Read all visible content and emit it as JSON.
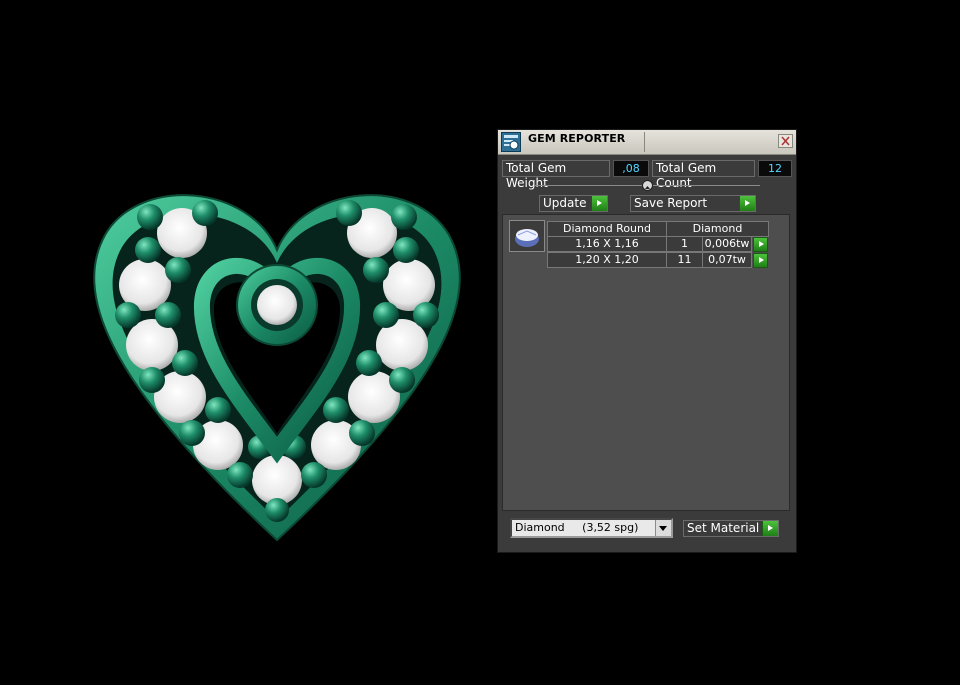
{
  "window": {
    "title": "GEM REPORTER"
  },
  "summary": {
    "weight_label": "Total Gem Weight",
    "weight_value": ",08",
    "count_label": "Total Gem Count",
    "count_value": "12"
  },
  "buttons": {
    "update": "Update",
    "save_report": "Save Report",
    "set_material": "Set Material"
  },
  "report": {
    "gem_type_header": "Diamond Round",
    "material_header": "Diamond",
    "rows": [
      {
        "size": "1,16 X 1,16",
        "count": "1",
        "weight": "0,006tw"
      },
      {
        "size": "1,20 X 1,20",
        "count": "11",
        "weight": "0,07tw"
      }
    ]
  },
  "material_select": {
    "value": "Diamond     (3,52 spg)"
  },
  "colors": {
    "metal": "#1f8f6a",
    "accent_value": "#55d7ff",
    "button_green": "#2fa024"
  }
}
